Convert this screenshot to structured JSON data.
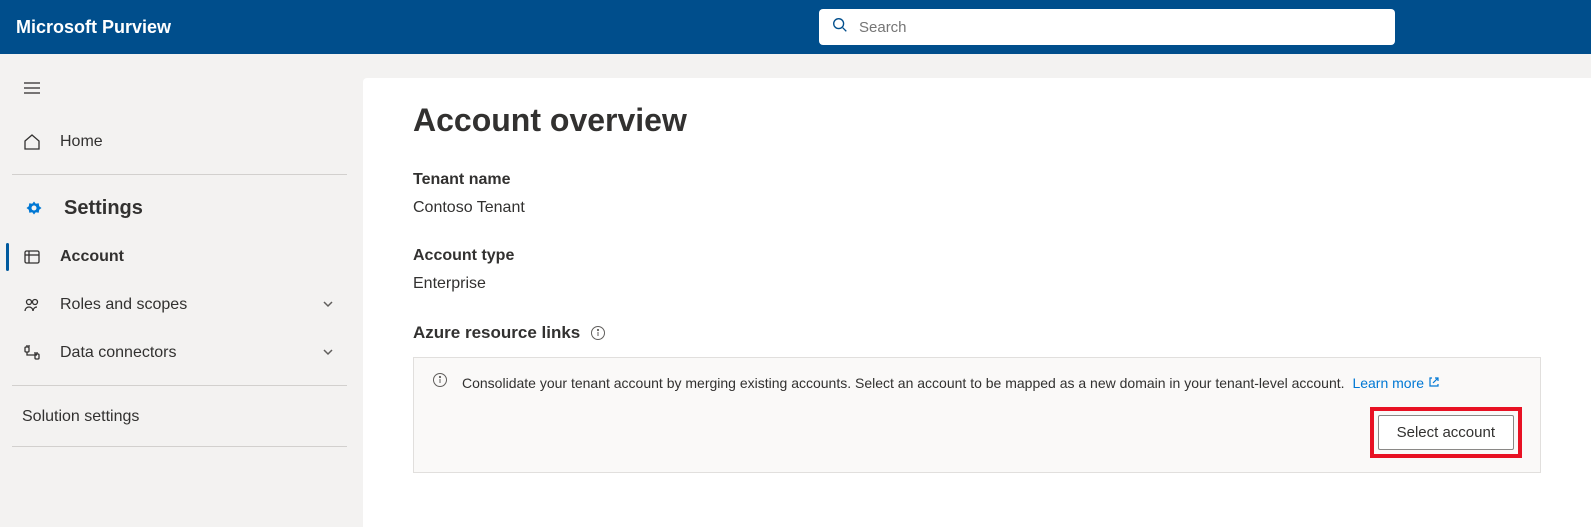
{
  "header": {
    "appTitle": "Microsoft Purview",
    "searchPlaceholder": "Search"
  },
  "sidebar": {
    "home": "Home",
    "settingsHeader": "Settings",
    "items": [
      {
        "label": "Account"
      },
      {
        "label": "Roles and scopes"
      },
      {
        "label": "Data connectors"
      }
    ],
    "solutionSettings": "Solution settings"
  },
  "main": {
    "title": "Account overview",
    "tenantNameLabel": "Tenant name",
    "tenantNameValue": "Contoso Tenant",
    "accountTypeLabel": "Account type",
    "accountTypeValue": "Enterprise",
    "azureLinksLabel": "Azure resource links",
    "bannerText": "Consolidate your tenant account by merging existing accounts. Select an account to be mapped as a new domain in your tenant-level account.",
    "learnMore": "Learn more",
    "selectAccountBtn": "Select account"
  }
}
